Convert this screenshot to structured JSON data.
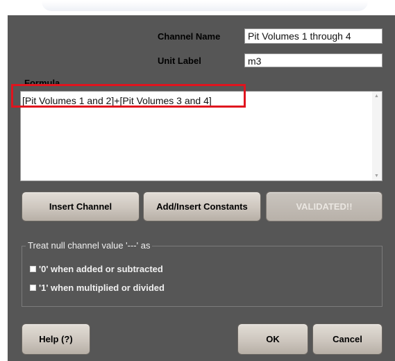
{
  "form": {
    "channel_name_label": "Channel Name",
    "channel_name_value": "Pit Volumes 1 through 4",
    "unit_label_label": "Unit Label",
    "unit_label_value": "m3",
    "formula_label": "Formula",
    "formula_value": "[Pit Volumes 1 and 2]+[Pit Volumes 3 and 4]"
  },
  "buttons": {
    "insert_channel": "Insert Channel",
    "add_insert_constants": "Add/Insert Constants",
    "validated": "VALIDATED!!",
    "help": "Help (?)",
    "ok": "OK",
    "cancel": "Cancel"
  },
  "null_options": {
    "title": "Treat null channel value '---' as",
    "option_zero": "'0' when added or subtracted",
    "option_one": "'1' when multiplied or divided"
  },
  "colors": {
    "dialog_background": "#565656",
    "highlight": "#e0141e"
  }
}
